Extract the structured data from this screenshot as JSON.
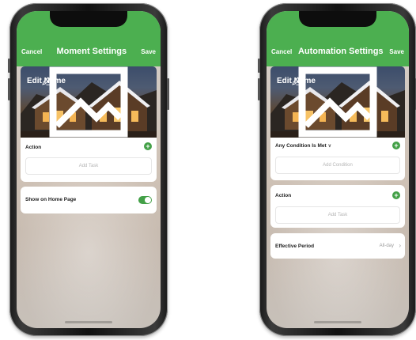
{
  "colors": {
    "accent": "#4caf50",
    "plus": "#43a047",
    "card": "#ffffff",
    "muted_text": "#b5b5b5"
  },
  "left": {
    "nav": {
      "cancel": "Cancel",
      "title": "Moment Settings",
      "save": "Save"
    },
    "hero": {
      "edit_label": "Edit Name",
      "edit_icon": "pencil-icon",
      "image_icon": "image-icon"
    },
    "action": {
      "label": "Action",
      "add_label": "Add Task",
      "plus_icon": "plus-circle-icon"
    },
    "home_toggle": {
      "label": "Show on Home Page",
      "on": true
    }
  },
  "right": {
    "nav": {
      "cancel": "Cancel",
      "title": "Automation Settings",
      "save": "Save"
    },
    "hero": {
      "edit_label": "Edit Name",
      "edit_icon": "pencil-icon",
      "image_icon": "image-icon"
    },
    "condition": {
      "label": "Any Condition Is Met",
      "chevron_icon": "chevron-down-icon",
      "add_label": "Add Condition",
      "plus_icon": "plus-circle-icon"
    },
    "action": {
      "label": "Action",
      "add_label": "Add Task",
      "plus_icon": "plus-circle-icon"
    },
    "period": {
      "label": "Effective Period",
      "value": "All-day",
      "chevron_icon": "chevron-right-icon"
    }
  }
}
